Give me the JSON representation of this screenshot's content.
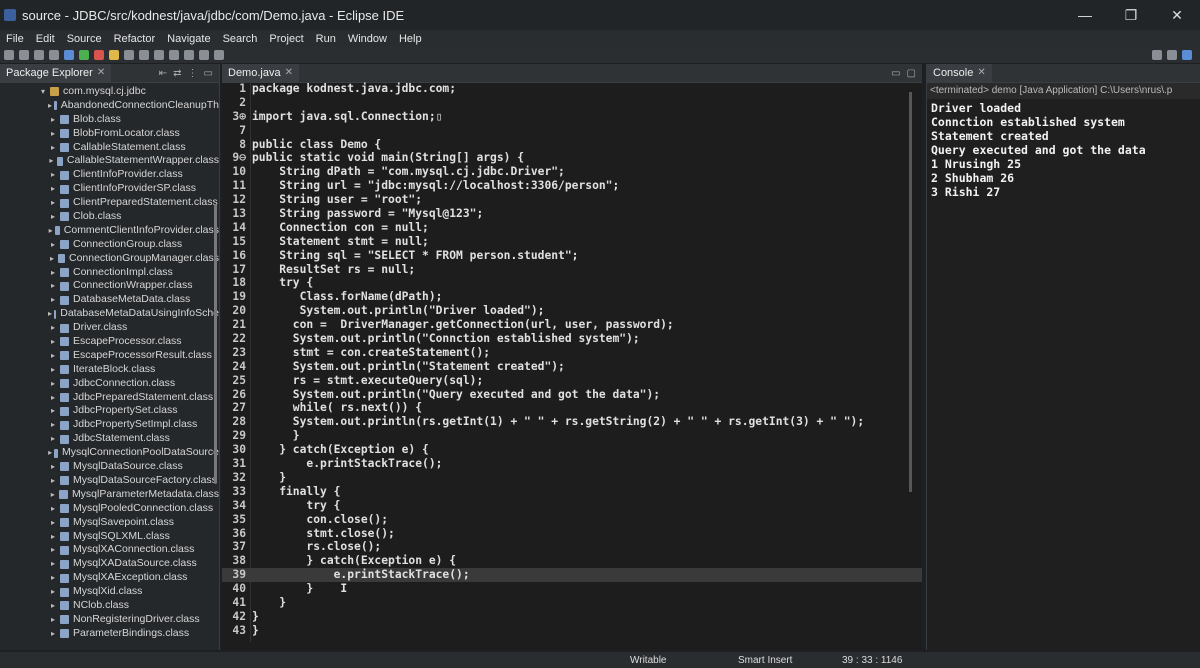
{
  "window": {
    "title": "source - JDBC/src/kodnest/java/jdbc/com/Demo.java - Eclipse IDE",
    "minimize": "—",
    "maximize": "❐",
    "close": "✕"
  },
  "menu": [
    "File",
    "Edit",
    "Source",
    "Refactor",
    "Navigate",
    "Search",
    "Project",
    "Run",
    "Window",
    "Help"
  ],
  "package_explorer": {
    "tab_label": "Package Explorer",
    "close": "✕",
    "root": "com.mysql.cj.jdbc",
    "items": [
      "AbandonedConnectionCleanupTh",
      "Blob.class",
      "BlobFromLocator.class",
      "CallableStatement.class",
      "CallableStatementWrapper.class",
      "ClientInfoProvider.class",
      "ClientInfoProviderSP.class",
      "ClientPreparedStatement.class",
      "Clob.class",
      "CommentClientInfoProvider.class",
      "ConnectionGroup.class",
      "ConnectionGroupManager.class",
      "ConnectionImpl.class",
      "ConnectionWrapper.class",
      "DatabaseMetaData.class",
      "DatabaseMetaDataUsingInfoSche",
      "Driver.class",
      "EscapeProcessor.class",
      "EscapeProcessorResult.class",
      "IterateBlock.class",
      "JdbcConnection.class",
      "JdbcPreparedStatement.class",
      "JdbcPropertySet.class",
      "JdbcPropertySetImpl.class",
      "JdbcStatement.class",
      "MysqlConnectionPoolDataSource",
      "MysqlDataSource.class",
      "MysqlDataSourceFactory.class",
      "MysqlParameterMetadata.class",
      "MysqlPooledConnection.class",
      "MysqlSavepoint.class",
      "MysqlSQLXML.class",
      "MysqlXAConnection.class",
      "MysqlXADataSource.class",
      "MysqlXAException.class",
      "MysqlXid.class",
      "NClob.class",
      "NonRegisteringDriver.class",
      "ParameterBindings.class"
    ]
  },
  "editor": {
    "tab_label": "Demo.java",
    "close": "✕",
    "lines": [
      {
        "n": "1",
        "t": "package kodnest.java.jdbc.com;"
      },
      {
        "n": "2",
        "t": ""
      },
      {
        "n": "3⊕",
        "t": "import java.sql.Connection;▯"
      },
      {
        "n": "7",
        "t": ""
      },
      {
        "n": "8",
        "t": "public class Demo {"
      },
      {
        "n": "9⊖",
        "t": "public static void main(String[] args) {"
      },
      {
        "n": "10",
        "t": "    String dPath = \"com.mysql.cj.jdbc.Driver\";"
      },
      {
        "n": "11",
        "t": "    String url = \"jdbc:mysql://localhost:3306/person\";"
      },
      {
        "n": "12",
        "t": "    String user = \"root\";"
      },
      {
        "n": "13",
        "t": "    String password = \"Mysql@123\";"
      },
      {
        "n": "14",
        "t": "    Connection con = null;"
      },
      {
        "n": "15",
        "t": "    Statement stmt = null;"
      },
      {
        "n": "16",
        "t": "    String sql = \"SELECT * FROM person.student\";"
      },
      {
        "n": "17",
        "t": "    ResultSet rs = null;"
      },
      {
        "n": "18",
        "t": "    try {"
      },
      {
        "n": "19",
        "t": "       Class.forName(dPath);"
      },
      {
        "n": "20",
        "t": "       System.out.println(\"Driver loaded\");"
      },
      {
        "n": "21",
        "t": "      con =  DriverManager.getConnection(url, user, password);"
      },
      {
        "n": "22",
        "t": "      System.out.println(\"Connction established system\");"
      },
      {
        "n": "23",
        "t": "      stmt = con.createStatement();"
      },
      {
        "n": "24",
        "t": "      System.out.println(\"Statement created\");"
      },
      {
        "n": "25",
        "t": "      rs = stmt.executeQuery(sql);"
      },
      {
        "n": "26",
        "t": "      System.out.println(\"Query executed and got the data\");"
      },
      {
        "n": "27",
        "t": "      while( rs.next()) {"
      },
      {
        "n": "28",
        "t": "      System.out.println(rs.getInt(1) + \" \" + rs.getString(2) + \" \" + rs.getInt(3) + \" \");"
      },
      {
        "n": "29",
        "t": "      }"
      },
      {
        "n": "30",
        "t": "    } catch(Exception e) {"
      },
      {
        "n": "31",
        "t": "        e.printStackTrace();"
      },
      {
        "n": "32",
        "t": "    }"
      },
      {
        "n": "33",
        "t": "    finally {"
      },
      {
        "n": "34",
        "t": "        try {"
      },
      {
        "n": "35",
        "t": "        con.close();"
      },
      {
        "n": "36",
        "t": "        stmt.close();"
      },
      {
        "n": "37",
        "t": "        rs.close();"
      },
      {
        "n": "38",
        "t": "        } catch(Exception e) {"
      },
      {
        "n": "39",
        "t": "            e.printStackTrace();"
      },
      {
        "n": "40",
        "t": "        }    I"
      },
      {
        "n": "41",
        "t": "    }"
      },
      {
        "n": "42",
        "t": "}"
      },
      {
        "n": "43",
        "t": "}"
      }
    ],
    "current_line": "39"
  },
  "console": {
    "tab_label": "Console",
    "close": "✕",
    "terminated": "<terminated> demo [Java Application] C:\\Users\\nrus\\.p",
    "output": [
      "Driver loaded",
      "Connction established system",
      "Statement created",
      "Query executed and got the data",
      "1 Nrusingh 25",
      "2 Shubham 26",
      "3 Rishi 27"
    ]
  },
  "status": {
    "mode": "Writable",
    "insert": "Smart Insert",
    "position": "39 : 33 : 1146"
  }
}
